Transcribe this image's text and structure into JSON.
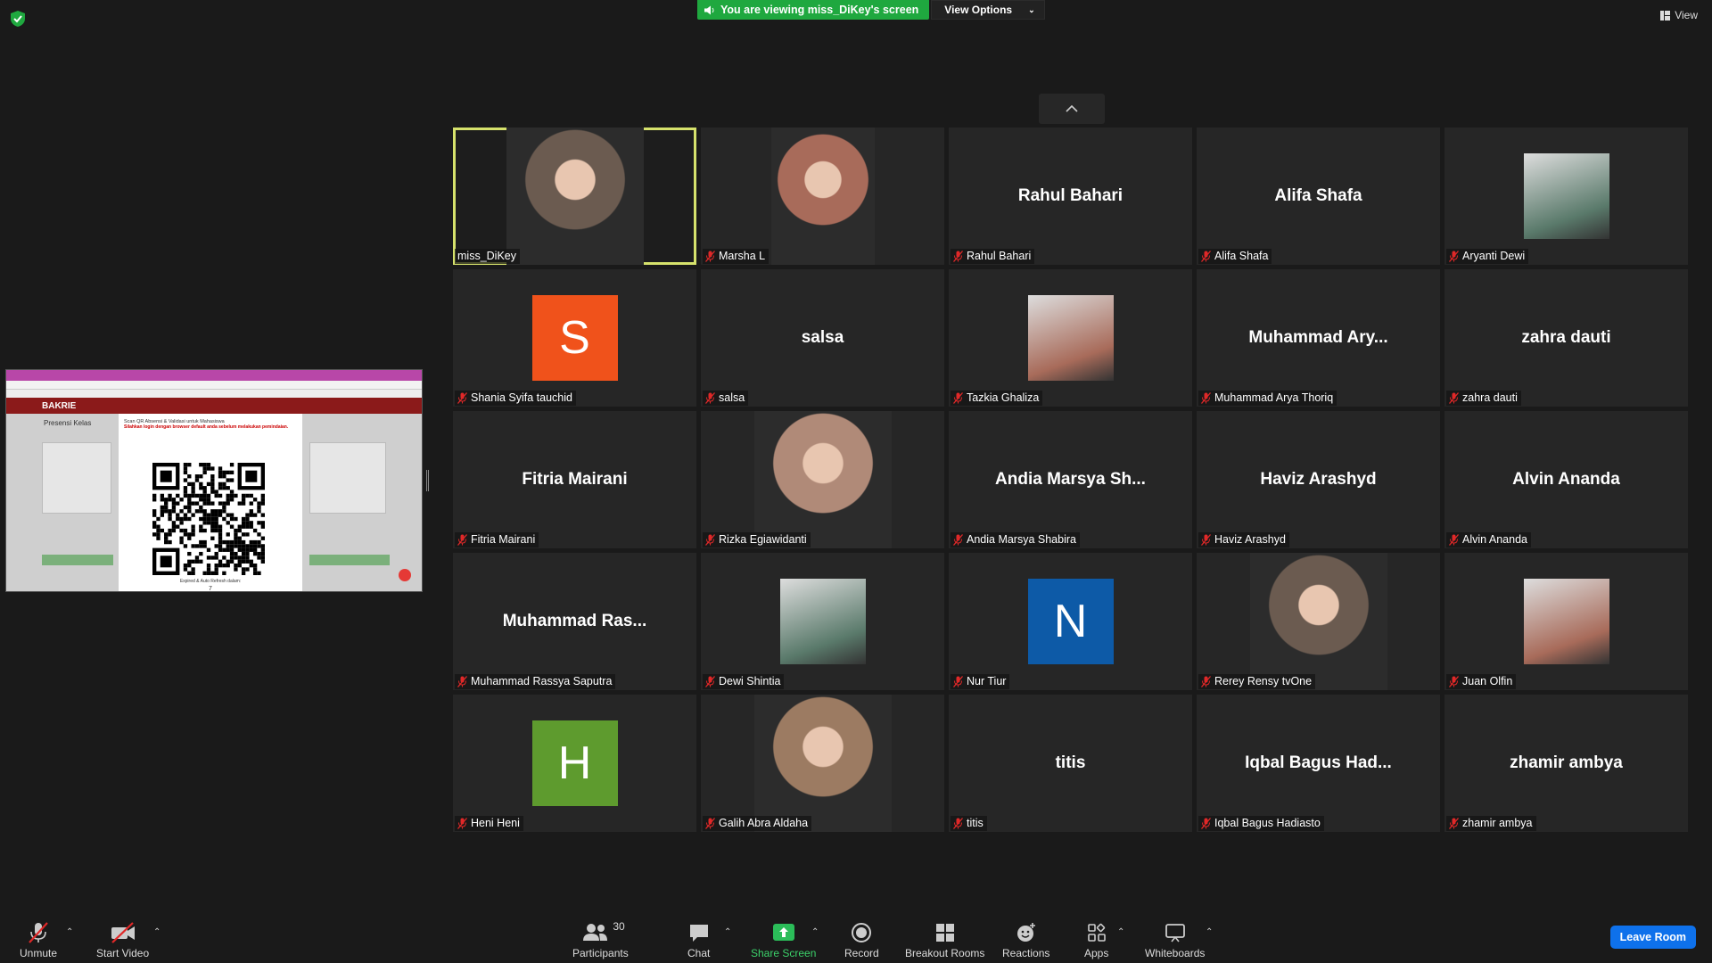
{
  "banner": {
    "message": "You are viewing miss_DiKey's screen",
    "view_options": "View Options"
  },
  "view_label": "View",
  "participants": [
    {
      "name": "miss_DiKey",
      "display": "",
      "kind": "photo",
      "muted": false,
      "active": true
    },
    {
      "name": "Marsha L",
      "display": "",
      "kind": "photo",
      "muted": true
    },
    {
      "name": "Rahul Bahari",
      "display": "Rahul Bahari",
      "kind": "name",
      "muted": true
    },
    {
      "name": "Alifa Shafa",
      "display": "Alifa Shafa",
      "kind": "name",
      "muted": true
    },
    {
      "name": "Aryanti Dewi",
      "display": "",
      "kind": "photo-sq",
      "muted": true
    },
    {
      "name": "Shania Syifa tauchid",
      "display": "S",
      "kind": "avatar",
      "color": "#f0521b",
      "muted": true
    },
    {
      "name": "salsa",
      "display": "salsa",
      "kind": "name",
      "muted": true
    },
    {
      "name": "Tazkia Ghaliza",
      "display": "",
      "kind": "photo-sq",
      "muted": true
    },
    {
      "name": "Muhammad Arya Thoriq",
      "display": "Muhammad  Ary...",
      "kind": "name",
      "muted": true
    },
    {
      "name": "zahra dauti",
      "display": "zahra dauti",
      "kind": "name",
      "muted": true
    },
    {
      "name": "Fitria Mairani",
      "display": "Fitria Mairani",
      "kind": "name",
      "muted": true
    },
    {
      "name": "Rizka Egiawidanti",
      "display": "",
      "kind": "photo",
      "muted": true
    },
    {
      "name": "Andia Marsya Shabira",
      "display": "Andia  Marsya  Sh...",
      "kind": "name",
      "muted": true
    },
    {
      "name": "Haviz Arashyd",
      "display": "Haviz Arashyd",
      "kind": "name",
      "muted": true
    },
    {
      "name": "Alvin Ananda",
      "display": "Alvin Ananda",
      "kind": "name",
      "muted": true
    },
    {
      "name": "Muhammad Rassya Saputra",
      "display": "Muhammad  Ras...",
      "kind": "name",
      "muted": true
    },
    {
      "name": "Dewi Shintia",
      "display": "",
      "kind": "photo-sq",
      "muted": true
    },
    {
      "name": "Nur Tiur",
      "display": "N",
      "kind": "avatar",
      "color": "#0d5aa7",
      "muted": true
    },
    {
      "name": "Rerey Rensy tvOne",
      "display": "",
      "kind": "photo",
      "muted": true
    },
    {
      "name": "Juan Olfin",
      "display": "",
      "kind": "photo-sq",
      "muted": true
    },
    {
      "name": "Heni Heni",
      "display": "H",
      "kind": "avatar",
      "color": "#5e9b2e",
      "muted": true
    },
    {
      "name": "Galih Abra Aldaha",
      "display": "",
      "kind": "photo",
      "muted": true
    },
    {
      "name": "titis",
      "display": "titis",
      "kind": "name",
      "muted": true
    },
    {
      "name": "Iqbal Bagus Hadiasto",
      "display": "Iqbal Bagus Had...",
      "kind": "name",
      "muted": true
    },
    {
      "name": "zhamir ambya",
      "display": "zhamir ambya",
      "kind": "name",
      "muted": true
    }
  ],
  "shared_screen": {
    "brand": "BAKRIE",
    "page_title": "Presensi Kelas",
    "modal_title": "Scan QR Absensi & Validasi untuk Mahasiswa",
    "modal_warning": "Silahkan login dengan browser default anda sebelum melakukan pemindaian.",
    "modal_footer": "Expired & Auto Refresh dalam:",
    "modal_count": "7"
  },
  "toolbar": {
    "unmute": "Unmute",
    "start_video": "Start Video",
    "participants": "Participants",
    "participants_count": "30",
    "chat": "Chat",
    "share_screen": "Share Screen",
    "record": "Record",
    "breakout": "Breakout Rooms",
    "reactions": "Reactions",
    "apps": "Apps",
    "whiteboards": "Whiteboards",
    "leave": "Leave Room"
  }
}
